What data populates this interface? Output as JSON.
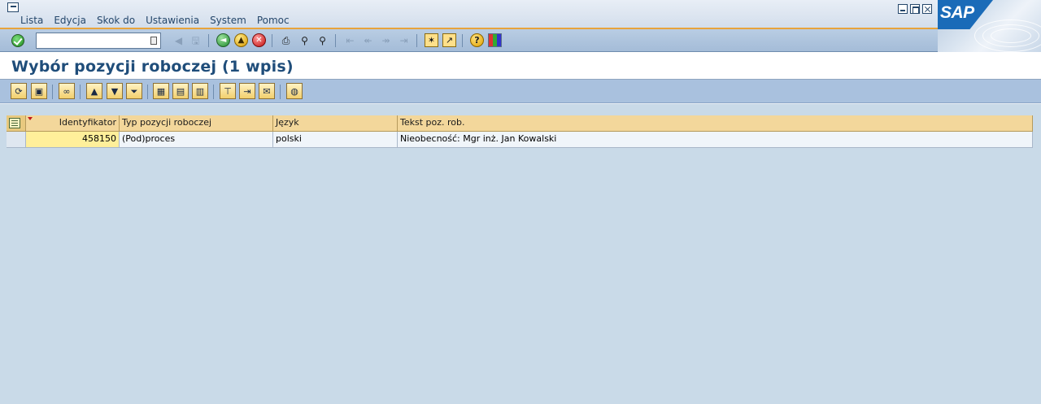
{
  "menubar": {
    "items": [
      "Lista",
      "Edycja",
      "Skok do",
      "Ustawienia",
      "System",
      "Pomoc"
    ],
    "brand": "SAP"
  },
  "toolbar": {
    "command_field_value": "",
    "icons": [
      "enter-icon",
      "back-arrow-icon",
      "save-icon",
      "back-icon",
      "exit-icon",
      "cancel-icon",
      "print-icon",
      "find-icon",
      "find-next-icon",
      "first-page-icon",
      "previous-page-icon",
      "next-page-icon",
      "last-page-icon",
      "create-session-icon",
      "shortcut-icon",
      "help-icon",
      "customize-layout-icon"
    ]
  },
  "title": {
    "text": "Wybór pozycji roboczej (1 wpis)"
  },
  "app_toolbar": {
    "icons": [
      "refresh-icon",
      "details-icon",
      "glasses-icon",
      "sort-asc-icon",
      "filter-icon",
      "filter-settings-icon",
      "grid-view-icon",
      "column-select-icon",
      "column-save-icon",
      "export-icon",
      "local-file-icon",
      "send-icon",
      "graphic-icon"
    ]
  },
  "table": {
    "columns": [
      "Identyfikator",
      "Typ pozycji roboczej",
      "Język",
      "Tekst poz. rob."
    ],
    "rows": [
      [
        "458150",
        "(Pod)proces",
        "polski",
        "Nieobecność: Mgr inż. Jan Kowalski"
      ]
    ]
  },
  "colors": {
    "menu_accent": "#e8a33c",
    "title_text": "#1f4d7a",
    "content_bg": "#c9dae8",
    "header_bg": "#f3d79b",
    "key_cell_bg": "#ffef9a",
    "sap_blue": "#1a6bb8"
  }
}
